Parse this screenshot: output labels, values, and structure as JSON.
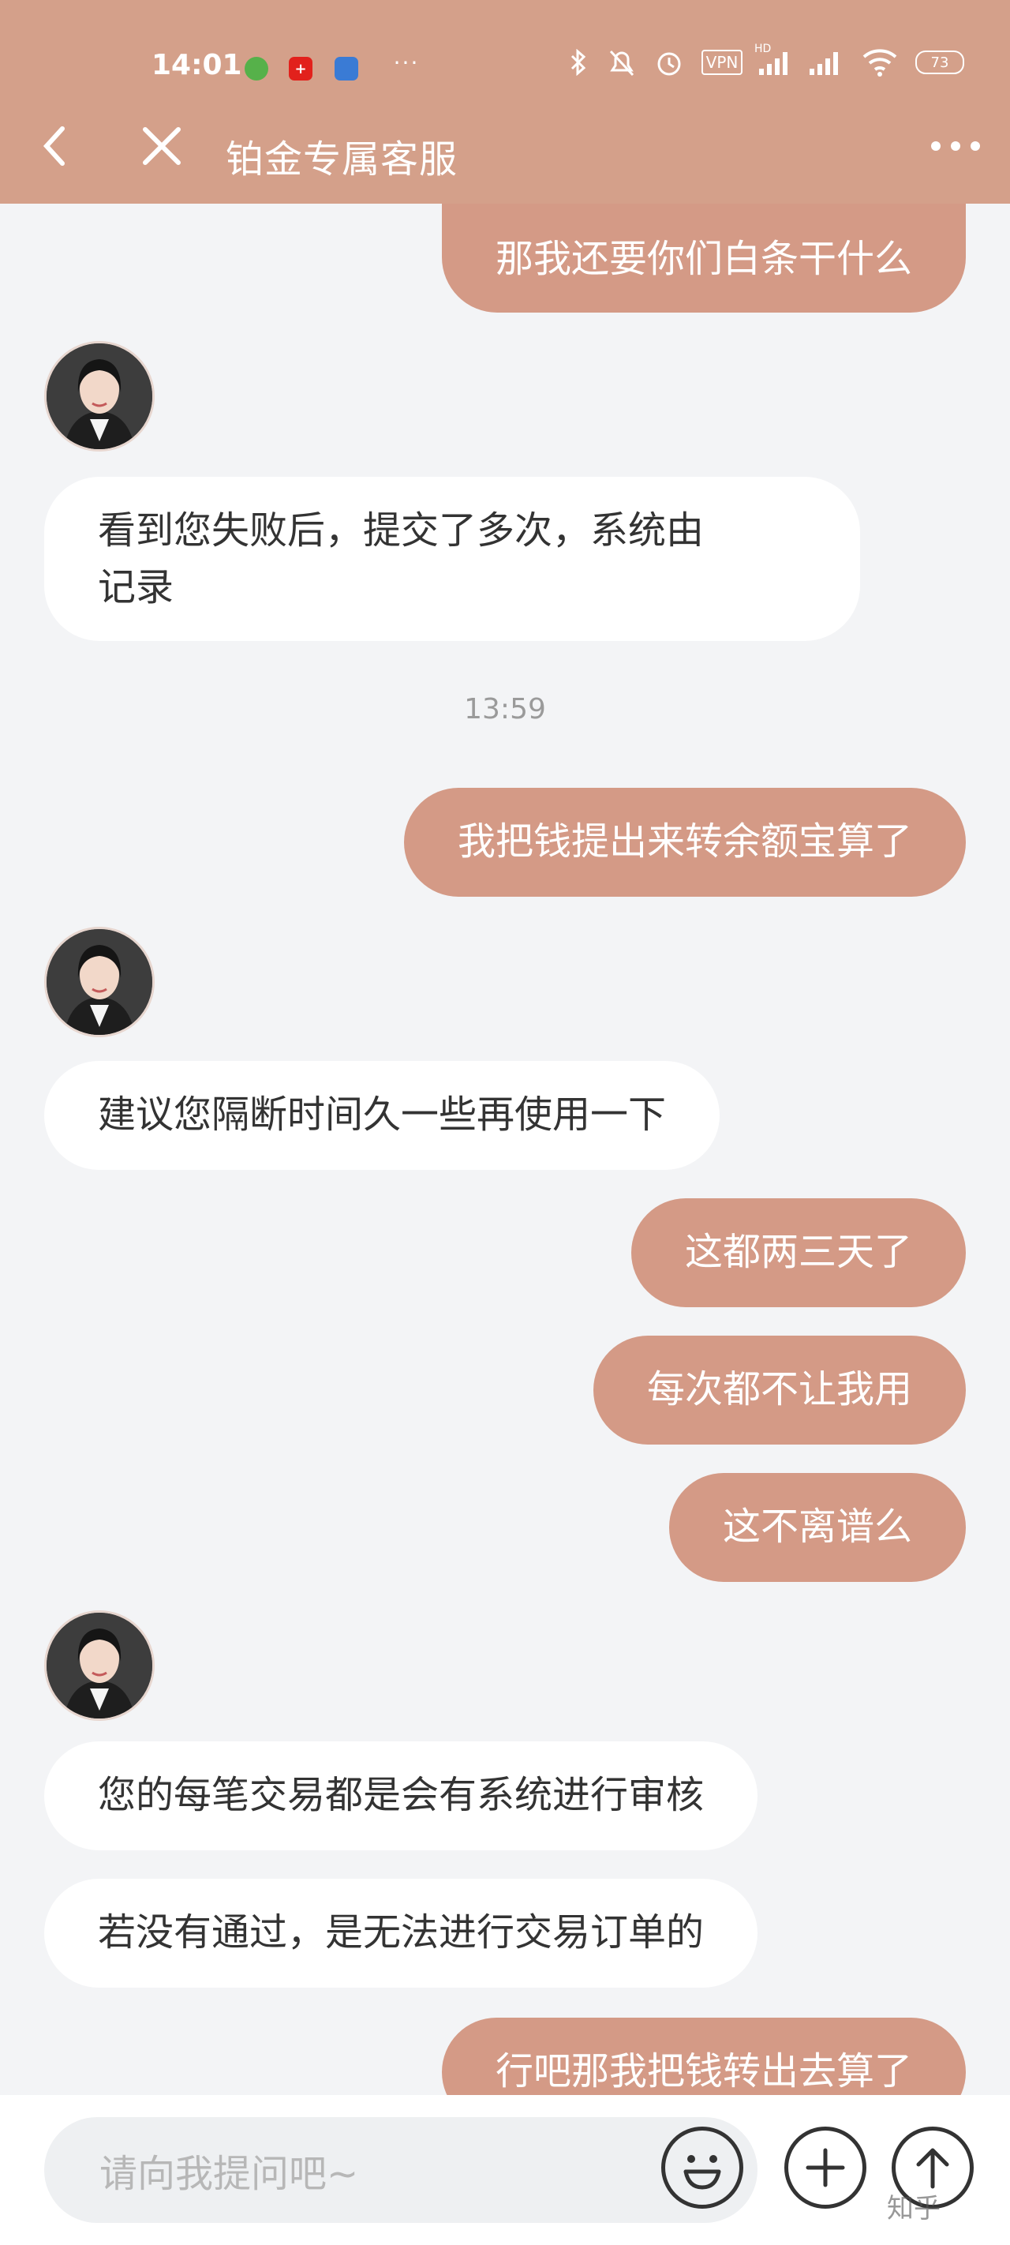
{
  "status_bar": {
    "time": "14:01",
    "vpn": "VPN",
    "hd": "HD",
    "battery": "73"
  },
  "header": {
    "title": "铂金专属客服"
  },
  "messages": [
    {
      "from": "me",
      "text": "那我还要你们白条干什么"
    },
    {
      "from": "them",
      "lines": [
        "看到您失败后，提交了多次，系统由",
        "记录"
      ]
    },
    {
      "timestamp": "13:59"
    },
    {
      "from": "me",
      "text": "我把钱提出来转余额宝算了"
    },
    {
      "from": "them",
      "text": "建议您隔断时间久一些再使用一下"
    },
    {
      "from": "me",
      "text": "这都两三天了"
    },
    {
      "from": "me",
      "text": "每次都不让我用"
    },
    {
      "from": "me",
      "text": "这不离谱么"
    },
    {
      "from": "them",
      "text": "您的每笔交易都是会有系统进行审核"
    },
    {
      "from": "them",
      "text": "若没有通过，是无法进行交易订单的"
    },
    {
      "from": "me",
      "text": "行吧那我把钱转出去算了"
    }
  ],
  "input": {
    "placeholder": "请向我提问吧~"
  },
  "watermark": "知乎",
  "colors": {
    "header_bg": "#d4a08a",
    "my_bubble": "#d49a86",
    "their_bubble": "#ffffff",
    "background": "#f3f4f6"
  }
}
